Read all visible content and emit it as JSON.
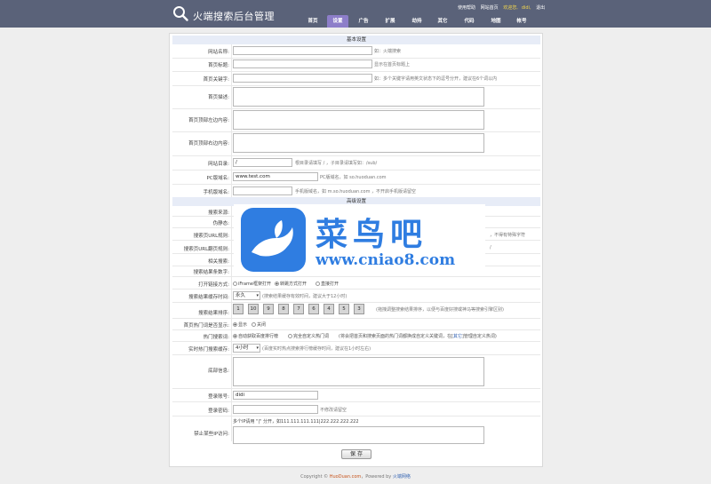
{
  "header": {
    "title": "火端搜索后台管理",
    "links": {
      "help": "使用帮助",
      "home": "网站首页",
      "welcome": "欢迎您,",
      "user": "didi,",
      "logout": "退出"
    },
    "nav": [
      {
        "label": "首页"
      },
      {
        "label": "设置"
      },
      {
        "label": "广告"
      },
      {
        "label": "扩展"
      },
      {
        "label": "劫持"
      },
      {
        "label": "其它"
      },
      {
        "label": "代码"
      },
      {
        "label": "地图"
      },
      {
        "label": "帐号"
      }
    ],
    "active_nav": "设置"
  },
  "basic": {
    "title": "基本设置",
    "site_name": {
      "label": "网站名称:",
      "value": "",
      "hint": "如：火端搜索"
    },
    "home_title": {
      "label": "首页标题:",
      "value": "",
      "hint": "显示在首页标题上"
    },
    "home_keywords": {
      "label": "首页关键字:",
      "value": "",
      "hint": "如：多个关键字请用英文状态下的逗号分开，建议在6个词以内"
    },
    "home_desc": {
      "label": "首页描述:",
      "value": ""
    },
    "top_left": {
      "label": "首页顶部左边内容:",
      "value": ""
    },
    "top_right": {
      "label": "首页顶部右边内容:",
      "value": ""
    },
    "site_dir": {
      "label": "网站目录:",
      "value": "/",
      "hint": "根目录请填写 / ，子目录请填写如：/sub/"
    },
    "pc_domain": {
      "label": "PC版域名:",
      "value": "www.test.com",
      "hint": "PC版域名，如 so.huoduan.com"
    },
    "mobile_domain": {
      "label": "手机版域名:",
      "value": "",
      "hint": "手机版域名，如 m.so.huoduan.com ，不开启手机版请留空"
    }
  },
  "advanced": {
    "title": "高级设置",
    "search_src": {
      "label": "搜索来源:"
    },
    "pseudo_static": {
      "label": "伪静态:"
    },
    "search_url_rule": {
      "label": "搜索页URL规则:",
      "hint": "，不得有特殊字符"
    },
    "search_url_rule2": {
      "label": "搜索页URL翻页规则:",
      "hint": "/"
    },
    "related": {
      "label": "相关搜索:"
    },
    "result_count": {
      "label": "搜索结果条数字:"
    },
    "open_mode": {
      "label": "打开链接方式:",
      "options": [
        "iFrame框架打开",
        "转跳方式打开",
        "直接打开"
      ],
      "selected": "转跳方式打开"
    },
    "cache_time": {
      "label": "搜索结果缓存时间:",
      "value": "永久",
      "hint": "(搜索结果缓存有效时间，建议大于12小时)"
    },
    "rank": {
      "label": "搜索结果排序:",
      "values": [
        "1",
        "10",
        "9",
        "8",
        "7",
        "6",
        "4",
        "5",
        "3"
      ],
      "hint": "(拖拽调整搜索结果排序，以便与百度好搜或神马等搜索引擎区别)"
    },
    "hot_show": {
      "label": "首页热门词是否显示:",
      "options": [
        "显示",
        "关闭"
      ],
      "selected": "显示"
    },
    "hot_words": {
      "label": "热门搜索词:",
      "options": [
        "自动获取百度排行榜",
        "完全自定义热门词"
      ],
      "selected": "自动获取百度排行榜",
      "hint_a": "(将会把首页和搜索页面的热门词都换成自定义关键词，在[",
      "hint_link": "其它",
      "hint_b": "]管理自定义热词)"
    },
    "hot_cache": {
      "label": "实时热门搜索缓存:",
      "value": "4小时",
      "hint": "(百度实时热点搜索排行榜缓存时间，建议在1小时左右)"
    },
    "footer_info": {
      "label": "底部信息:",
      "value": ""
    },
    "login_user": {
      "label": "登录账号:",
      "value": "didi"
    },
    "login_pass": {
      "label": "登录密码:",
      "value": "",
      "hint": "不修改请留空"
    },
    "ban_ip": {
      "label": "禁止某些IP访问:",
      "note": "多个IP请用 \"|\" 分开，如111.111.111.111|222.222.222.222",
      "value": ""
    },
    "save": "保 存"
  },
  "footer": {
    "prefix": "Copyright ©",
    "site": "HuoDuan.com",
    "mid": "，Powered by",
    "brand": "火端网络"
  },
  "watermark": {
    "title": "菜鸟吧",
    "url": "www.cniao8.com",
    "color": "#2f7de1"
  },
  "colors": {
    "header_bg": "#5a6279",
    "active_tab": "#8d7ec9",
    "section_bg": "#e7ecf7"
  }
}
